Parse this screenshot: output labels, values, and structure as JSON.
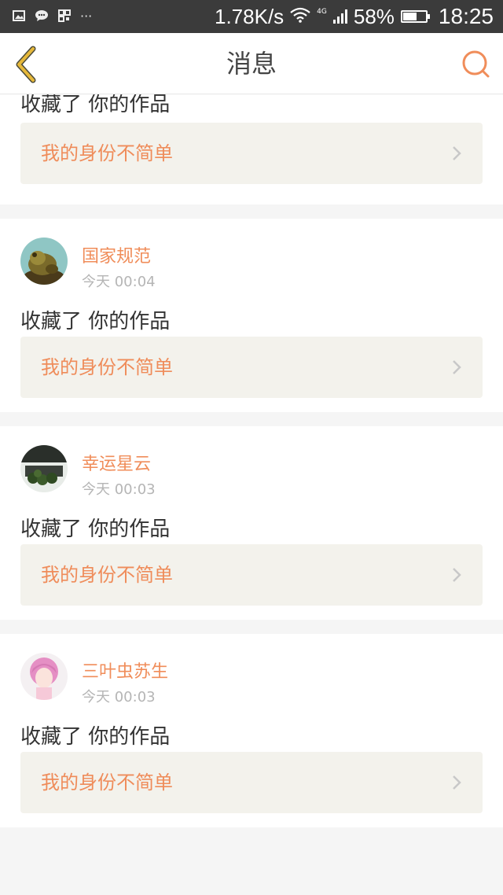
{
  "status_bar": {
    "left_icons": [
      "image-icon",
      "message-bubble-icon",
      "grid-icon",
      "more-dots-icon"
    ],
    "net_speed": "1.78K/s",
    "network_type": "4G",
    "battery": "58%",
    "battery_level": 0.58,
    "time": "18:25"
  },
  "header": {
    "title": "消息",
    "back_icon": "chevron-left-icon",
    "search_icon": "search-icon",
    "accent_color": "#f08d5a",
    "back_color": "#e6b83a"
  },
  "messages": [
    {
      "user": "",
      "time": "",
      "action": "收藏了 你的作品",
      "work_title": "我的身份不简单"
    },
    {
      "user": "国家规范",
      "time": "今天 00:04",
      "action": "收藏了 你的作品",
      "work_title": "我的身份不简单"
    },
    {
      "user": "幸运星云",
      "time": "今天 00:03",
      "action": "收藏了 你的作品",
      "work_title": "我的身份不简单"
    },
    {
      "user": "三叶虫苏生",
      "time": "今天 00:03",
      "action": "收藏了 你的作品",
      "work_title": "我的身份不简单"
    }
  ]
}
